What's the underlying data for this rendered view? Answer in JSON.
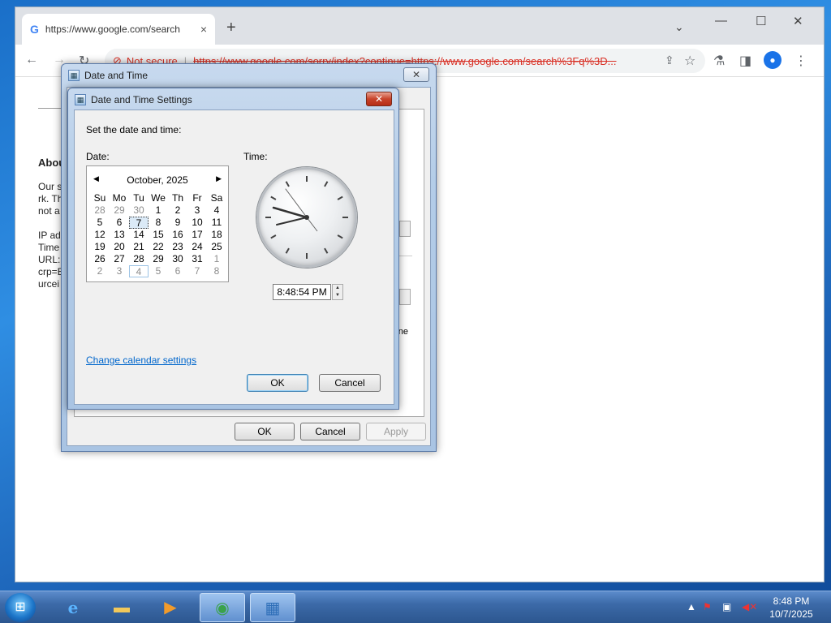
{
  "browser": {
    "tab_title": "https://www.google.com/search",
    "tab_close": "×",
    "new_tab": "+",
    "tab_search": "⌄",
    "minimize": "—",
    "maximize": "☐",
    "close": "✕",
    "back": "←",
    "forward": "→",
    "reload": "↻",
    "security_label": "Not secure",
    "url": "https://www.google.com/sorry/index?continue=https://www.google.com/search%3Fq%3D...",
    "avatar": "●"
  },
  "page": {
    "heading": "Abou",
    "lines": [
      "Our s",
      "rk. Th",
      "not a",
      "IP ad",
      "Time",
      "URL:",
      "crp=E",
      "urcei"
    ],
    "partial_right": "ne"
  },
  "outer_dialog": {
    "title": "Date and Time",
    "close": "✕",
    "ok": "OK",
    "cancel": "Cancel",
    "apply": "Apply"
  },
  "inner_dialog": {
    "title": "Date and Time Settings",
    "close": "✕",
    "prompt": "Set the date and time:",
    "date_label": "Date:",
    "time_label": "Time:",
    "month_year": "October, 2025",
    "weekdays": [
      "Su",
      "Mo",
      "Tu",
      "We",
      "Th",
      "Fr",
      "Sa"
    ],
    "weeks": [
      [
        "28",
        "29",
        "30",
        "1",
        "2",
        "3",
        "4"
      ],
      [
        "5",
        "6",
        "7",
        "8",
        "9",
        "10",
        "11"
      ],
      [
        "12",
        "13",
        "14",
        "15",
        "16",
        "17",
        "18"
      ],
      [
        "19",
        "20",
        "21",
        "22",
        "23",
        "24",
        "25"
      ],
      [
        "26",
        "27",
        "28",
        "29",
        "30",
        "31",
        "1"
      ],
      [
        "2",
        "3",
        "4",
        "5",
        "6",
        "7",
        "8"
      ]
    ],
    "time_value": "8:48:54 PM",
    "spin_up": "▲",
    "spin_down": "▼",
    "calendar_link": "Change calendar settings",
    "ok": "OK",
    "cancel": "Cancel"
  },
  "taskbar": {
    "start": "⊞",
    "tray_arrow": "▲",
    "time": "8:48 PM",
    "date": "10/7/2025"
  }
}
